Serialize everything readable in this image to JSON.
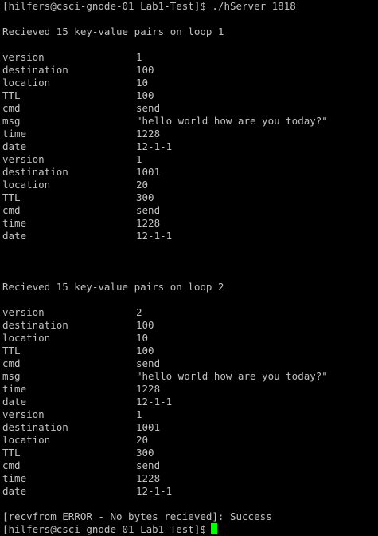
{
  "terminal": {
    "top_prompt": "[hilfers@csci-gnode-01 Lab1-Test]$ ./hServer 1818",
    "loops": [
      {
        "header": "Recieved 15 key-value pairs on loop 1",
        "pairs": [
          [
            "version",
            "1"
          ],
          [
            "destination",
            "100"
          ],
          [
            "location",
            "10"
          ],
          [
            "TTL",
            "100"
          ],
          [
            "cmd",
            "send"
          ],
          [
            "msg",
            "\"hello world how are you today?\""
          ],
          [
            "time",
            "1228"
          ],
          [
            "date",
            "12-1-1"
          ],
          [
            "version",
            "1"
          ],
          [
            "destination",
            "1001"
          ],
          [
            "location",
            "20"
          ],
          [
            "TTL",
            "300"
          ],
          [
            "cmd",
            "send"
          ],
          [
            "time",
            "1228"
          ],
          [
            "date",
            "12-1-1"
          ]
        ]
      },
      {
        "header": "Recieved 15 key-value pairs on loop 2",
        "pairs": [
          [
            "version",
            "2"
          ],
          [
            "destination",
            "100"
          ],
          [
            "location",
            "10"
          ],
          [
            "TTL",
            "100"
          ],
          [
            "cmd",
            "send"
          ],
          [
            "msg",
            "\"hello world how are you today?\""
          ],
          [
            "time",
            "1228"
          ],
          [
            "date",
            "12-1-1"
          ],
          [
            "version",
            "1"
          ],
          [
            "destination",
            "1001"
          ],
          [
            "location",
            "20"
          ],
          [
            "TTL",
            "300"
          ],
          [
            "cmd",
            "send"
          ],
          [
            "time",
            "1228"
          ],
          [
            "date",
            "12-1-1"
          ]
        ]
      }
    ],
    "error_line": "[recvfrom ERROR - No bytes recieved]: Success",
    "final_prompt": "[hilfers@csci-gnode-01 Lab1-Test]$"
  },
  "colors": {
    "background": "#000000",
    "text": "#c0c0c0",
    "cursor": "#00ff00"
  }
}
